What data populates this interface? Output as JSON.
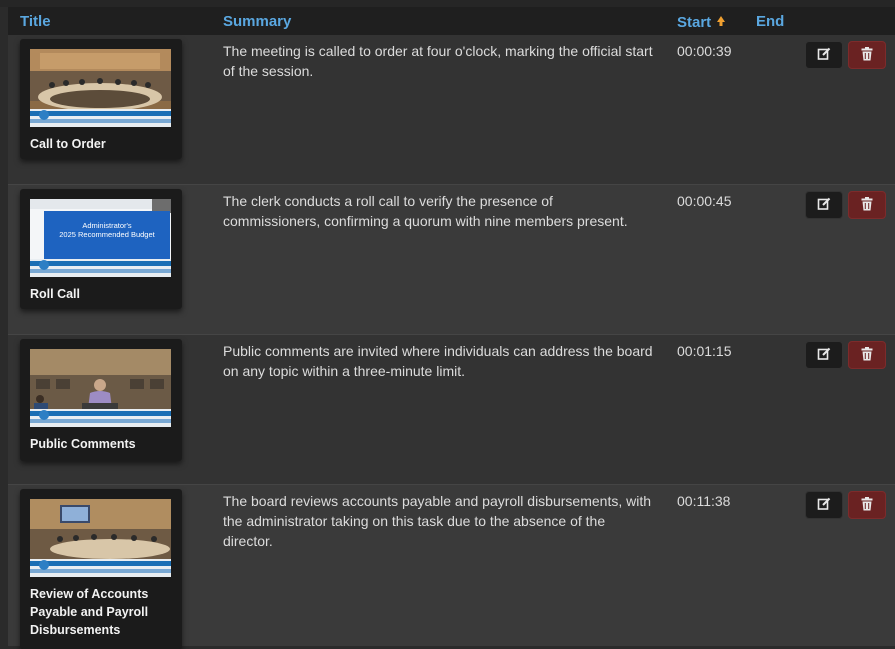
{
  "header": {
    "title": "Title",
    "summary": "Summary",
    "start": "Start",
    "end": "End",
    "sort_icon": "sort-ascending-icon"
  },
  "colors": {
    "header_text": "#5aa7e0",
    "sort_arrow": "#f0a030",
    "delete_button": "#6a2222",
    "edit_button": "#1c1c1c"
  },
  "rows": [
    {
      "title": "Call to Order",
      "summary": "The meeting is called to order at four o'clock, marking the official start of the session.",
      "start": "00:00:39",
      "end": "",
      "thumbnail": "meeting-room-wide"
    },
    {
      "title": "Roll Call",
      "summary": "The clerk conducts a roll call to verify the presence of commissioners, confirming a quorum with nine members present.",
      "start": "00:00:45",
      "end": "",
      "thumbnail": "budget-slide",
      "slide_title": "Administrator's",
      "slide_subtitle": "2025 Recommended Budget"
    },
    {
      "title": "Public Comments",
      "summary": "Public comments are invited where individuals can address the board on any topic within a three-minute limit.",
      "start": "00:01:15",
      "end": "",
      "thumbnail": "speaker-at-podium"
    },
    {
      "title": "Review of Accounts Payable and Payroll Disbursements",
      "summary": "The board reviews accounts payable and payroll disbursements, with the administrator taking on this task due to the absence of the director.",
      "start": "00:11:38",
      "end": "",
      "thumbnail": "meeting-room-screen"
    }
  ],
  "actions": {
    "edit_icon": "edit-icon",
    "delete_icon": "trash-icon"
  }
}
